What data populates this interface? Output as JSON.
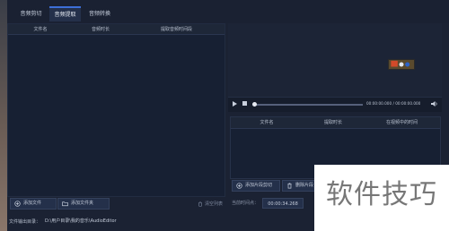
{
  "tabs": [
    {
      "label": "音频剪切"
    },
    {
      "label": "音频提取"
    },
    {
      "label": "音频转换"
    }
  ],
  "file_list": {
    "columns": [
      "文件名",
      "音频时长",
      "提取音频时间段"
    ]
  },
  "buttons": {
    "add_file": "添加文件",
    "add_folder": "添加文件夹",
    "clear_list": "清空列表",
    "add_segment": "添加片段剪切",
    "delete_segment": "删除片段"
  },
  "output": {
    "label": "文件输出目录：",
    "path": "D:\\用户目录\\我的音乐\\AudioEditor"
  },
  "player": {
    "time": "00:00:00.000 / 00:00:00.000"
  },
  "extract_list": {
    "columns": [
      "文件名",
      "提取时长",
      "在视频中的时间"
    ]
  },
  "current_time": {
    "label": "当前时间点：",
    "value": "00:00:34.268"
  },
  "watermark": "软件技巧",
  "colors": {
    "background": "#1b2233",
    "accent": "#3d6fd8"
  }
}
